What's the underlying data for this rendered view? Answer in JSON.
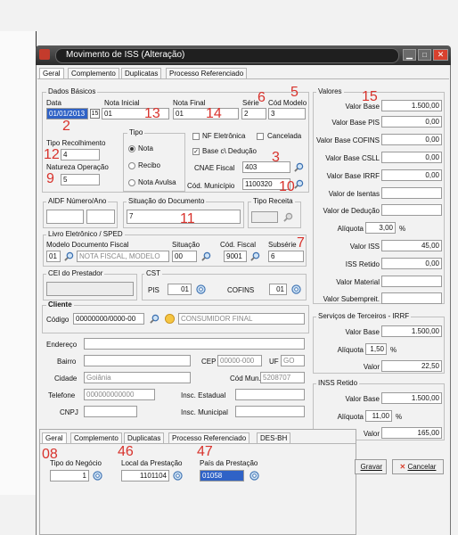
{
  "window": {
    "title": "Movimento de ISS (Alteração)"
  },
  "tabs": [
    "Geral",
    "Complemento",
    "Duplicatas",
    "Processo Referenciado"
  ],
  "tabs2": [
    "Geral",
    "Complemento",
    "Duplicatas",
    "Processo Referenciado",
    "DES-BH"
  ],
  "dados_basicos": {
    "title": "Dados Básicos",
    "data_label": "Data",
    "data_value": "01/01/2013",
    "nota_inicial_label": "Nota Inicial",
    "nota_inicial_value": "01",
    "nota_final_label": "Nota Final",
    "nota_final_value": "01",
    "serie_label": "Série",
    "serie_value": "2",
    "cod_modelo_label": "Cód Modelo",
    "cod_modelo_value": "3",
    "tipo_recolhimento_label": "Tipo Recolhimento",
    "tipo_recolhimento_value": "4",
    "natureza_operacao_label": "Natureza Operação",
    "natureza_operacao_value": "5",
    "tipo_label": "Tipo",
    "tipo_options": [
      "Nota",
      "Recibo",
      "Nota Avulsa"
    ],
    "nf_eletronica_label": "NF Eletrônica",
    "cancelada_label": "Cancelada",
    "base_deducao_label": "Base c\\ Dedução",
    "cnae_label": "CNAE Fiscal",
    "cnae_value": "403",
    "cod_municipio_label": "Cód. Município",
    "cod_municipio_value": "1100320"
  },
  "aidf": {
    "label": "AIDF Número/Ano"
  },
  "situacao": {
    "label": "Situação do Documento",
    "value": "7"
  },
  "tipo_receita": {
    "label": "Tipo Receita"
  },
  "livro": {
    "title": "Livro Eletrônico / SPED",
    "modelo_label": "Modelo Documento Fiscal",
    "modelo_code": "01",
    "modelo_name": "NOTA FISCAL, MODELO",
    "situacao_label": "Situação",
    "situacao_value": "00",
    "cod_fiscal_label": "Cód. Fiscal",
    "cod_fiscal_value": "9001",
    "subserie_label": "Subsérie",
    "subserie_value": "6"
  },
  "cei": {
    "label": "CEI do Prestador"
  },
  "cst": {
    "label": "CST",
    "pis_label": "PIS",
    "pis_value": "01",
    "cofins_label": "COFINS",
    "cofins_value": "01"
  },
  "cliente": {
    "title": "Cliente",
    "codigo_label": "Código",
    "codigo_value": "00000000/0000-00",
    "nome": "CONSUMIDOR FINAL",
    "endereco_label": "Endereço",
    "bairro_label": "Bairro",
    "cep_label": "CEP",
    "cep_value": "00000-000",
    "uf_label": "UF",
    "uf_value": "GO",
    "cidade_label": "Cidade",
    "cidade_value": "Goiânia",
    "cod_mun_label": "Cód Mun.",
    "cod_mun_value": "5208707",
    "telefone_label": "Telefone",
    "telefone_value": "000000000000",
    "insc_estadual_label": "Insc. Estadual",
    "cnpj_label": "CNPJ",
    "insc_municipal_label": "Insc. Municipal"
  },
  "valores": {
    "title": "Valores",
    "rows": [
      {
        "label": "Valor Base",
        "value": "1.500,00"
      },
      {
        "label": "Valor Base PIS",
        "value": "0,00"
      },
      {
        "label": "Valor Base COFINS",
        "value": "0,00"
      },
      {
        "label": "Valor Base CSLL",
        "value": "0,00"
      },
      {
        "label": "Valor Base IRRF",
        "value": "0,00"
      },
      {
        "label": "Valor de Isentas",
        "value": ""
      },
      {
        "label": "Valor de Dedução",
        "value": ""
      }
    ],
    "aliquota_label": "Alíquota",
    "aliquota_value": "3,00",
    "pct": "%",
    "valor_iss_label": "Valor ISS",
    "valor_iss_value": "45,00",
    "iss_retido_label": "ISS Retido",
    "iss_retido_value": "0,00",
    "valor_material_label": "Valor Material",
    "valor_subempreit_label": "Valor Subempreit."
  },
  "terceiros": {
    "title": "Serviços de Terceiros - IRRF",
    "valor_base_label": "Valor Base",
    "valor_base_value": "1.500,00",
    "aliquota_label": "Alíquota",
    "aliquota_value": "1,50",
    "valor_label": "Valor",
    "valor_value": "22,50"
  },
  "inss": {
    "title": "INSS Retido",
    "valor_base_label": "Valor Base",
    "valor_base_value": "1.500,00",
    "aliquota_label": "Alíquota",
    "aliquota_value": "11,00",
    "valor_label": "Valor",
    "valor_value": "165,00"
  },
  "des_bh": {
    "tipo_negocio_label": "Tipo do Negócio",
    "tipo_negocio_value": "1",
    "local_prestacao_label": "Local da Prestação",
    "local_prestacao_value": "1101104",
    "pais_prestacao_label": "País da Prestação",
    "pais_prestacao_value": "01058"
  },
  "buttons": {
    "gravar": "Gravar",
    "cancelar": "Cancelar"
  },
  "annotations": [
    "2",
    "5",
    "6",
    "7",
    "9",
    "10",
    "11",
    "12",
    "13",
    "14",
    "15",
    "3",
    "08",
    "46",
    "47"
  ],
  "colors": {
    "title_bar": "#3a3a3a",
    "selection": "#2f62c6",
    "annotation": "#d8322c",
    "close_button": "#d9412e"
  }
}
